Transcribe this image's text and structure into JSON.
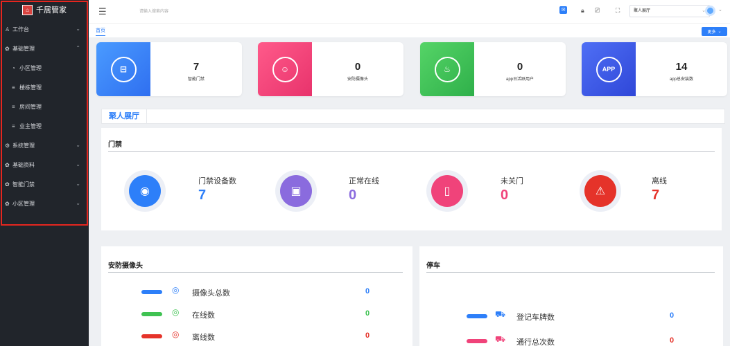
{
  "app": {
    "name": "千居管家"
  },
  "sidebar": {
    "items": [
      {
        "label": "工作台",
        "icon": "user-icon",
        "expanded": false
      },
      {
        "label": "基础管理",
        "icon": "gear-icon",
        "expanded": true
      },
      {
        "label": "小区管理",
        "icon": "community-icon",
        "sub": true
      },
      {
        "label": "楼栋管理",
        "icon": "list-icon",
        "sub": true
      },
      {
        "label": "房间管理",
        "icon": "list-icon",
        "sub": true
      },
      {
        "label": "业主管理",
        "icon": "list-icon",
        "sub": true
      },
      {
        "label": "系统管理",
        "icon": "settings-icon",
        "expanded": false
      },
      {
        "label": "基础资料",
        "icon": "gear-icon",
        "expanded": false
      },
      {
        "label": "智能门禁",
        "icon": "gear-icon",
        "expanded": false
      },
      {
        "label": "小区管理",
        "icon": "gear-icon",
        "expanded": false
      }
    ]
  },
  "topbar": {
    "search_placeholder": "请输入搜索内容",
    "project_select": "聚人展厅"
  },
  "tabs": {
    "home": "首页",
    "more": "更多"
  },
  "stats": [
    {
      "value": "7",
      "label": "智能门禁",
      "icon": "access-control-icon",
      "color": "#3b82f6"
    },
    {
      "value": "0",
      "label": "安防摄像头",
      "icon": "camera-user-icon",
      "color": "#f0437a"
    },
    {
      "value": "0",
      "label": "app日活跃用户",
      "icon": "active-user-icon",
      "color": "#3fc252"
    },
    {
      "value": "14",
      "label": "app总安装数",
      "icon": "app-icon",
      "color": "#3f5fe8"
    }
  ],
  "section": {
    "tab_label": "聚人展厅"
  },
  "access_panel": {
    "title": "门禁",
    "metrics": [
      {
        "label": "门禁设备数",
        "value": "7",
        "color": "#2d7ff9",
        "icon": "device-icon"
      },
      {
        "label": "正常在线",
        "value": "0",
        "color": "#8a6bde",
        "icon": "monitor-icon"
      },
      {
        "label": "未关门",
        "value": "0",
        "color": "#f0437a",
        "icon": "door-icon"
      },
      {
        "label": "离线",
        "value": "7",
        "color": "#e5332a",
        "icon": "warning-icon"
      }
    ]
  },
  "camera_panel": {
    "title": "安防摄像头",
    "rows": [
      {
        "label": "摄像头总数",
        "value": "0",
        "color": "#2d7ff9"
      },
      {
        "label": "在线数",
        "value": "0",
        "color": "#3fc252"
      },
      {
        "label": "离线数",
        "value": "0",
        "color": "#e5332a"
      }
    ]
  },
  "parking_panel": {
    "title": "停车",
    "rows": [
      {
        "label": "登记车牌数",
        "value": "0",
        "color": "#2d7ff9"
      },
      {
        "label": "通行总次数",
        "value": "0",
        "color": "#e5332a"
      }
    ]
  }
}
